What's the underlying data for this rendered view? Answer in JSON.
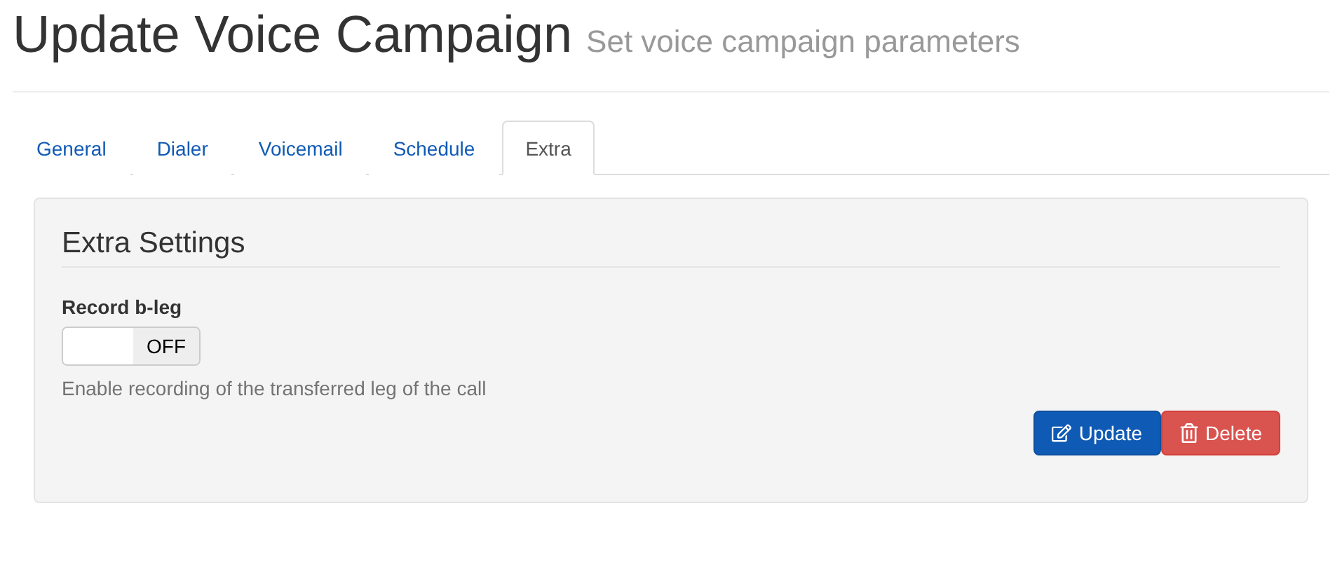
{
  "page": {
    "title": "Update Voice Campaign",
    "subtitle": "Set voice campaign parameters"
  },
  "tabs": [
    {
      "label": "General",
      "selected": false
    },
    {
      "label": "Dialer",
      "selected": false
    },
    {
      "label": "Voicemail",
      "selected": false
    },
    {
      "label": "Schedule",
      "selected": false
    },
    {
      "label": "Extra",
      "selected": true
    }
  ],
  "panel": {
    "title": "Extra Settings",
    "field": {
      "label": "Record b-leg",
      "toggle": {
        "on": false,
        "label": "OFF"
      },
      "help": "Enable recording of the transferred leg of the call"
    }
  },
  "buttons": [
    {
      "kind": "update",
      "label": "Update"
    },
    {
      "kind": "delete",
      "label": "Delete"
    }
  ]
}
